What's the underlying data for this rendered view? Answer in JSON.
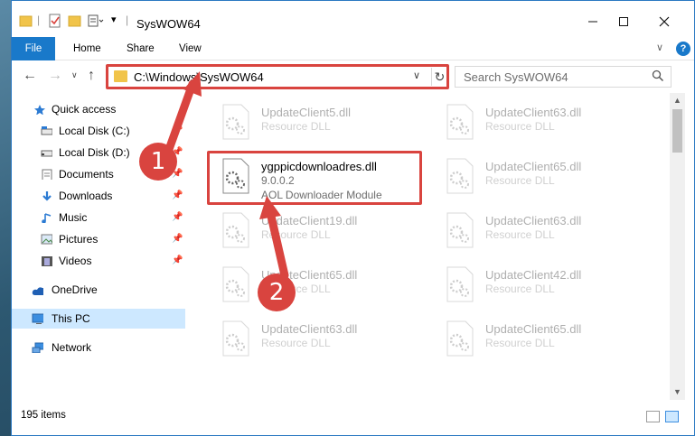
{
  "window": {
    "title": "SysWOW64"
  },
  "ribbon": {
    "tabs": [
      "File",
      "Home",
      "Share",
      "View"
    ]
  },
  "address": {
    "path": "C:\\Windows\\SysWOW64"
  },
  "search": {
    "placeholder": "Search SysWOW64"
  },
  "sidebar": {
    "items": [
      {
        "label": "Quick access",
        "icon": "star-icon"
      },
      {
        "label": "Local Disk (C:)",
        "icon": "drive-icon"
      },
      {
        "label": "Local Disk (D:)",
        "icon": "drive-icon"
      },
      {
        "label": "Documents",
        "icon": "documents-icon"
      },
      {
        "label": "Downloads",
        "icon": "downloads-icon"
      },
      {
        "label": "Music",
        "icon": "music-icon"
      },
      {
        "label": "Pictures",
        "icon": "pictures-icon"
      },
      {
        "label": "Videos",
        "icon": "videos-icon"
      },
      {
        "label": "OneDrive",
        "icon": "cloud-icon"
      },
      {
        "label": "This PC",
        "icon": "computer-icon"
      },
      {
        "label": "Network",
        "icon": "network-icon"
      }
    ]
  },
  "files": [
    {
      "name": "UpdateClient5.dll",
      "line2": "Resource DLL"
    },
    {
      "name": "UpdateClient63.dll",
      "line2": "Resource DLL"
    },
    {
      "name": "ygppicdownloadres.dll",
      "line2": "9.0.0.2",
      "line3": "AOL Downloader Module"
    },
    {
      "name": "UpdateClient65.dll",
      "line2": "Resource DLL"
    },
    {
      "name": "UpdateClient19.dll",
      "line2": "Resource DLL"
    },
    {
      "name": "UpdateClient63.dll",
      "line2": "Resource DLL"
    },
    {
      "name": "UpdateClient65.dll",
      "line2": "Resource DLL"
    },
    {
      "name": "UpdateClient42.dll",
      "line2": "Resource DLL"
    },
    {
      "name": "UpdateClient63.dll",
      "line2": "Resource DLL"
    },
    {
      "name": "UpdateClient65.dll",
      "line2": "Resource DLL"
    }
  ],
  "status": {
    "count": "195 items"
  },
  "callouts": {
    "one": "1",
    "two": "2"
  },
  "colors": {
    "accent": "#1979ca",
    "highlight": "#d9443f",
    "selected": "#cde8ff"
  }
}
